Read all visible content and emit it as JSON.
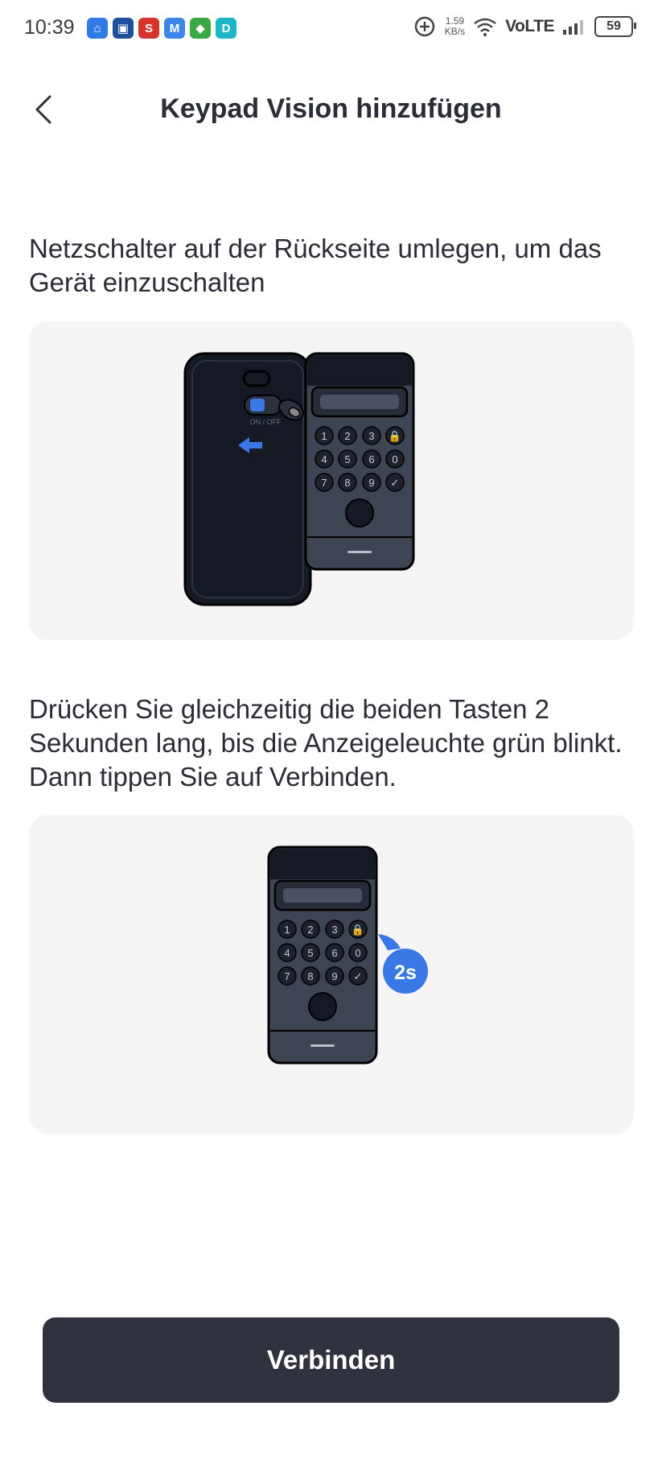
{
  "status_bar": {
    "time": "10:39",
    "speed_value": "1.59",
    "speed_unit": "KB/s",
    "network": "VoLTE",
    "battery": "59",
    "app_icons": [
      {
        "name": "home-app-icon",
        "color": "#2f7ae5",
        "glyph": "⌂"
      },
      {
        "name": "video-app-icon",
        "color": "#1f4f9b",
        "glyph": "▣"
      },
      {
        "name": "s-app-icon",
        "color": "#d6332f",
        "glyph": "S"
      },
      {
        "name": "m-app-icon",
        "color": "#3b86e8",
        "glyph": "M"
      },
      {
        "name": "shield-app-icon",
        "color": "#3aa845",
        "glyph": "◆"
      },
      {
        "name": "d-app-icon",
        "color": "#1fb5c9",
        "glyph": "D"
      }
    ]
  },
  "header": {
    "title": "Keypad Vision hinzufügen"
  },
  "steps": [
    {
      "text": "Netzschalter auf der Rückseite umlegen, um das Gerät einzuschalten",
      "switch_label": "ON / OFF"
    },
    {
      "text": "Drücken Sie gleichzeitig die beiden Tasten 2 Sekunden lang, bis die Anzeigeleuchte grün blinkt. Dann tippen Sie auf Verbinden.",
      "hold_badge": "2s"
    }
  ],
  "keypad_keys": [
    "1",
    "2",
    "3",
    "🔒",
    "4",
    "5",
    "6",
    "0",
    "7",
    "8",
    "9",
    "✓"
  ],
  "connect_button": {
    "label": "Verbinden"
  },
  "colors": {
    "accent": "#3b78e7",
    "device_dark": "#141923",
    "device_body": "#3d4452",
    "button_bg": "#30333e"
  }
}
